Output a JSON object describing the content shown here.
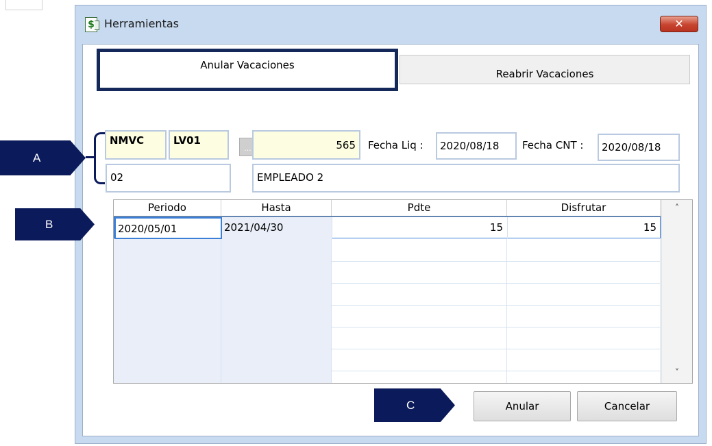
{
  "window": {
    "title": "Herramientas",
    "close_label": "✕"
  },
  "tabs": [
    {
      "label": "Anular Vacaciones",
      "active": true
    },
    {
      "label": "Reabrir Vacaciones",
      "active": false
    }
  ],
  "form": {
    "code1": "NMVC",
    "code2": "LV01",
    "lookup_label": "...",
    "number": "565",
    "fecha_liq_label": "Fecha Liq :",
    "fecha_liq_value": "2020/08/18",
    "fecha_cnt_label": "Fecha CNT :",
    "fecha_cnt_value": "2020/08/18",
    "employee_code": "02",
    "employee_name": "EMPLEADO 2"
  },
  "grid": {
    "columns": [
      "Periodo",
      "Hasta",
      "Pdte",
      "Disfrutar"
    ],
    "rows": [
      {
        "periodo": "2020/05/01",
        "hasta": "2021/04/30",
        "pdte": "15",
        "disfrutar": "15"
      }
    ],
    "scroll_up": "˄",
    "scroll_down": "˅"
  },
  "buttons": {
    "anular": "Anular",
    "cancelar": "Cancelar"
  },
  "callouts": {
    "a": "A",
    "b": "B",
    "c": "C"
  },
  "colors": {
    "callout": "#0b1a5a",
    "window_frame": "#c7daf0",
    "field_yellow": "#fdfde2",
    "selection": "#3c7fd6"
  }
}
